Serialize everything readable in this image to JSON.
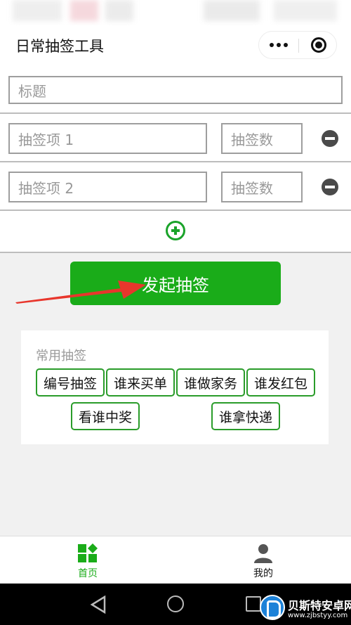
{
  "nav": {
    "title": "日常抽签工具"
  },
  "form": {
    "title_placeholder": "标题",
    "items": [
      {
        "name_placeholder": "抽签项 1",
        "count_placeholder": "抽签数"
      },
      {
        "name_placeholder": "抽签项 2",
        "count_placeholder": "抽签数"
      }
    ]
  },
  "start_button": {
    "label": "发起抽签"
  },
  "common": {
    "title": "常用抽签",
    "chips": [
      "编号抽签",
      "谁来买单",
      "谁做家务",
      "谁发红包",
      "看谁中奖",
      "谁拿快递"
    ]
  },
  "tabbar": {
    "items": [
      {
        "label": "首页",
        "icon": "home-grid-icon",
        "active": true
      },
      {
        "label": "我的",
        "icon": "person-icon",
        "active": false
      }
    ]
  },
  "watermark": {
    "name": "贝斯特安卓网",
    "url": "www.zjbstyy.com"
  },
  "colors": {
    "accent": "#1aac19",
    "annotation_arrow": "#e8362c"
  }
}
